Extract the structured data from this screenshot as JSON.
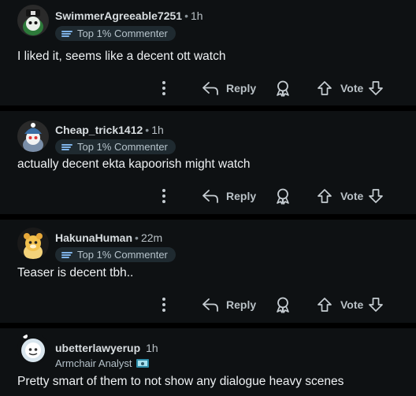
{
  "comments": [
    {
      "author": "SwimmerAgreeable7251",
      "time": "1h",
      "badge": "Top 1% Commenter",
      "text": "I liked it, seems like a decent ott watch",
      "avatar_color": "#2d7a3a"
    },
    {
      "author": "Cheap_trick1412",
      "time": "1h",
      "badge": "Top 1% Commenter",
      "text": "actually decent ekta kapoorish might watch",
      "avatar_color": "#3b6ea5"
    },
    {
      "author": "HakunaHuman",
      "time": "22m",
      "badge": "Top 1% Commenter",
      "text": "Teaser is decent tbh..",
      "avatar_color": "#e8b840"
    },
    {
      "author": "ubetterlawyerup",
      "time": "1h",
      "flair": "Armchair Analyst",
      "text": "Pretty smart of them to not show any dialogue heavy scenes",
      "avatar_color": "#d9e6ee"
    }
  ],
  "actions": {
    "reply_label": "Reply",
    "vote_label": "Vote"
  },
  "icons": [
    "more-icon",
    "reply-icon",
    "award-icon",
    "upvote-icon",
    "downvote-icon",
    "commenter-badge-icon",
    "flair-emoji-icon"
  ],
  "colors": {
    "background": "#0e1113",
    "badge_bg": "#1f2a30",
    "text": "#f2f4f5"
  }
}
